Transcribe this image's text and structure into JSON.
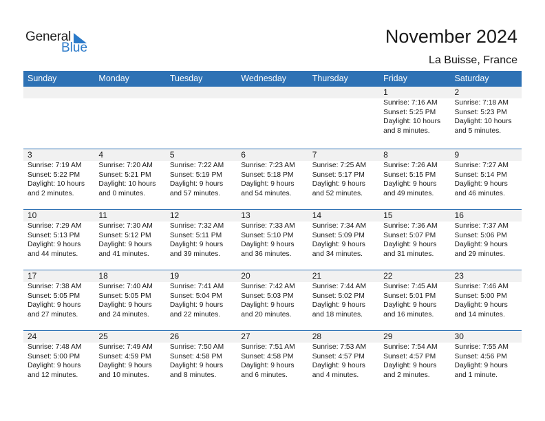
{
  "logo": {
    "line1": "General",
    "line2": "Blue"
  },
  "header": {
    "title": "November 2024",
    "location": "La Buisse, France"
  },
  "colors": {
    "accent": "#2e72b5",
    "logo_blue": "#2b7ac9",
    "date_band": "#f1f1f1"
  },
  "weekdays": [
    "Sunday",
    "Monday",
    "Tuesday",
    "Wednesday",
    "Thursday",
    "Friday",
    "Saturday"
  ],
  "weeks": [
    [
      null,
      null,
      null,
      null,
      null,
      {
        "day": "1",
        "sunrise": "Sunrise: 7:16 AM",
        "sunset": "Sunset: 5:25 PM",
        "daylight1": "Daylight: 10 hours",
        "daylight2": "and 8 minutes."
      },
      {
        "day": "2",
        "sunrise": "Sunrise: 7:18 AM",
        "sunset": "Sunset: 5:23 PM",
        "daylight1": "Daylight: 10 hours",
        "daylight2": "and 5 minutes."
      }
    ],
    [
      {
        "day": "3",
        "sunrise": "Sunrise: 7:19 AM",
        "sunset": "Sunset: 5:22 PM",
        "daylight1": "Daylight: 10 hours",
        "daylight2": "and 2 minutes."
      },
      {
        "day": "4",
        "sunrise": "Sunrise: 7:20 AM",
        "sunset": "Sunset: 5:21 PM",
        "daylight1": "Daylight: 10 hours",
        "daylight2": "and 0 minutes."
      },
      {
        "day": "5",
        "sunrise": "Sunrise: 7:22 AM",
        "sunset": "Sunset: 5:19 PM",
        "daylight1": "Daylight: 9 hours",
        "daylight2": "and 57 minutes."
      },
      {
        "day": "6",
        "sunrise": "Sunrise: 7:23 AM",
        "sunset": "Sunset: 5:18 PM",
        "daylight1": "Daylight: 9 hours",
        "daylight2": "and 54 minutes."
      },
      {
        "day": "7",
        "sunrise": "Sunrise: 7:25 AM",
        "sunset": "Sunset: 5:17 PM",
        "daylight1": "Daylight: 9 hours",
        "daylight2": "and 52 minutes."
      },
      {
        "day": "8",
        "sunrise": "Sunrise: 7:26 AM",
        "sunset": "Sunset: 5:15 PM",
        "daylight1": "Daylight: 9 hours",
        "daylight2": "and 49 minutes."
      },
      {
        "day": "9",
        "sunrise": "Sunrise: 7:27 AM",
        "sunset": "Sunset: 5:14 PM",
        "daylight1": "Daylight: 9 hours",
        "daylight2": "and 46 minutes."
      }
    ],
    [
      {
        "day": "10",
        "sunrise": "Sunrise: 7:29 AM",
        "sunset": "Sunset: 5:13 PM",
        "daylight1": "Daylight: 9 hours",
        "daylight2": "and 44 minutes."
      },
      {
        "day": "11",
        "sunrise": "Sunrise: 7:30 AM",
        "sunset": "Sunset: 5:12 PM",
        "daylight1": "Daylight: 9 hours",
        "daylight2": "and 41 minutes."
      },
      {
        "day": "12",
        "sunrise": "Sunrise: 7:32 AM",
        "sunset": "Sunset: 5:11 PM",
        "daylight1": "Daylight: 9 hours",
        "daylight2": "and 39 minutes."
      },
      {
        "day": "13",
        "sunrise": "Sunrise: 7:33 AM",
        "sunset": "Sunset: 5:10 PM",
        "daylight1": "Daylight: 9 hours",
        "daylight2": "and 36 minutes."
      },
      {
        "day": "14",
        "sunrise": "Sunrise: 7:34 AM",
        "sunset": "Sunset: 5:09 PM",
        "daylight1": "Daylight: 9 hours",
        "daylight2": "and 34 minutes."
      },
      {
        "day": "15",
        "sunrise": "Sunrise: 7:36 AM",
        "sunset": "Sunset: 5:07 PM",
        "daylight1": "Daylight: 9 hours",
        "daylight2": "and 31 minutes."
      },
      {
        "day": "16",
        "sunrise": "Sunrise: 7:37 AM",
        "sunset": "Sunset: 5:06 PM",
        "daylight1": "Daylight: 9 hours",
        "daylight2": "and 29 minutes."
      }
    ],
    [
      {
        "day": "17",
        "sunrise": "Sunrise: 7:38 AM",
        "sunset": "Sunset: 5:05 PM",
        "daylight1": "Daylight: 9 hours",
        "daylight2": "and 27 minutes."
      },
      {
        "day": "18",
        "sunrise": "Sunrise: 7:40 AM",
        "sunset": "Sunset: 5:05 PM",
        "daylight1": "Daylight: 9 hours",
        "daylight2": "and 24 minutes."
      },
      {
        "day": "19",
        "sunrise": "Sunrise: 7:41 AM",
        "sunset": "Sunset: 5:04 PM",
        "daylight1": "Daylight: 9 hours",
        "daylight2": "and 22 minutes."
      },
      {
        "day": "20",
        "sunrise": "Sunrise: 7:42 AM",
        "sunset": "Sunset: 5:03 PM",
        "daylight1": "Daylight: 9 hours",
        "daylight2": "and 20 minutes."
      },
      {
        "day": "21",
        "sunrise": "Sunrise: 7:44 AM",
        "sunset": "Sunset: 5:02 PM",
        "daylight1": "Daylight: 9 hours",
        "daylight2": "and 18 minutes."
      },
      {
        "day": "22",
        "sunrise": "Sunrise: 7:45 AM",
        "sunset": "Sunset: 5:01 PM",
        "daylight1": "Daylight: 9 hours",
        "daylight2": "and 16 minutes."
      },
      {
        "day": "23",
        "sunrise": "Sunrise: 7:46 AM",
        "sunset": "Sunset: 5:00 PM",
        "daylight1": "Daylight: 9 hours",
        "daylight2": "and 14 minutes."
      }
    ],
    [
      {
        "day": "24",
        "sunrise": "Sunrise: 7:48 AM",
        "sunset": "Sunset: 5:00 PM",
        "daylight1": "Daylight: 9 hours",
        "daylight2": "and 12 minutes."
      },
      {
        "day": "25",
        "sunrise": "Sunrise: 7:49 AM",
        "sunset": "Sunset: 4:59 PM",
        "daylight1": "Daylight: 9 hours",
        "daylight2": "and 10 minutes."
      },
      {
        "day": "26",
        "sunrise": "Sunrise: 7:50 AM",
        "sunset": "Sunset: 4:58 PM",
        "daylight1": "Daylight: 9 hours",
        "daylight2": "and 8 minutes."
      },
      {
        "day": "27",
        "sunrise": "Sunrise: 7:51 AM",
        "sunset": "Sunset: 4:58 PM",
        "daylight1": "Daylight: 9 hours",
        "daylight2": "and 6 minutes."
      },
      {
        "day": "28",
        "sunrise": "Sunrise: 7:53 AM",
        "sunset": "Sunset: 4:57 PM",
        "daylight1": "Daylight: 9 hours",
        "daylight2": "and 4 minutes."
      },
      {
        "day": "29",
        "sunrise": "Sunrise: 7:54 AM",
        "sunset": "Sunset: 4:57 PM",
        "daylight1": "Daylight: 9 hours",
        "daylight2": "and 2 minutes."
      },
      {
        "day": "30",
        "sunrise": "Sunrise: 7:55 AM",
        "sunset": "Sunset: 4:56 PM",
        "daylight1": "Daylight: 9 hours",
        "daylight2": "and 1 minute."
      }
    ]
  ]
}
